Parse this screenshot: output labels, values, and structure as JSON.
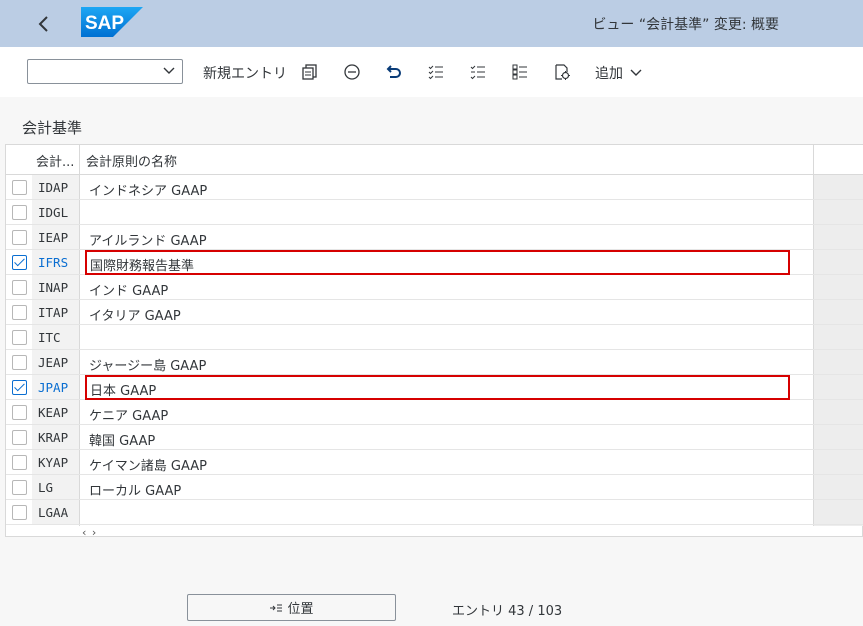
{
  "shell": {
    "title": "ビュー “会計基準” 変更: 概要",
    "logo_text": "SAP",
    "back_icon": "chevron-left-icon"
  },
  "toolbar": {
    "variant_value": "",
    "new_entries_label": "新規エントリ",
    "more_label": "追加",
    "icons": [
      "copy-icon",
      "delete-icon",
      "undo-icon",
      "select-all-icon",
      "deselect-all-icon",
      "select-block-icon",
      "details-icon"
    ]
  },
  "section": {
    "title": "会計基準"
  },
  "table": {
    "columns": [
      "会計...",
      "会計原則の名称"
    ],
    "rows": [
      {
        "code": "IDAP",
        "name": "インドネシア GAAP",
        "checked": false,
        "highlighted": false
      },
      {
        "code": "IDGL",
        "name": "",
        "checked": false,
        "highlighted": false
      },
      {
        "code": "IEAP",
        "name": "アイルランド GAAP",
        "checked": false,
        "highlighted": false
      },
      {
        "code": "IFRS",
        "name": "国際財務報告基準",
        "checked": true,
        "highlighted": true
      },
      {
        "code": "INAP",
        "name": "インド GAAP",
        "checked": false,
        "highlighted": false
      },
      {
        "code": "ITAP",
        "name": "イタリア GAAP",
        "checked": false,
        "highlighted": false
      },
      {
        "code": "ITC",
        "name": "",
        "checked": false,
        "highlighted": false
      },
      {
        "code": "JEAP",
        "name": "ジャージー島 GAAP",
        "checked": false,
        "highlighted": false
      },
      {
        "code": "JPAP",
        "name": "日本 GAAP",
        "checked": true,
        "highlighted": true
      },
      {
        "code": "KEAP",
        "name": "ケニア GAAP",
        "checked": false,
        "highlighted": false
      },
      {
        "code": "KRAP",
        "name": "韓国 GAAP",
        "checked": false,
        "highlighted": false
      },
      {
        "code": "KYAP",
        "name": "ケイマン諸島 GAAP",
        "checked": false,
        "highlighted": false
      },
      {
        "code": "LG",
        "name": "ローカル GAAP",
        "checked": false,
        "highlighted": false
      },
      {
        "code": "LGAA",
        "name": "",
        "checked": false,
        "highlighted": false
      }
    ],
    "scroll_hint": "‹ ›"
  },
  "footer": {
    "position_label": "位置",
    "entries_text": "エントリ 43 / 103"
  },
  "colors": {
    "shell_bg": "#bbcde4",
    "accent": "#0a6ed1",
    "highlight_border": "#d60000"
  }
}
